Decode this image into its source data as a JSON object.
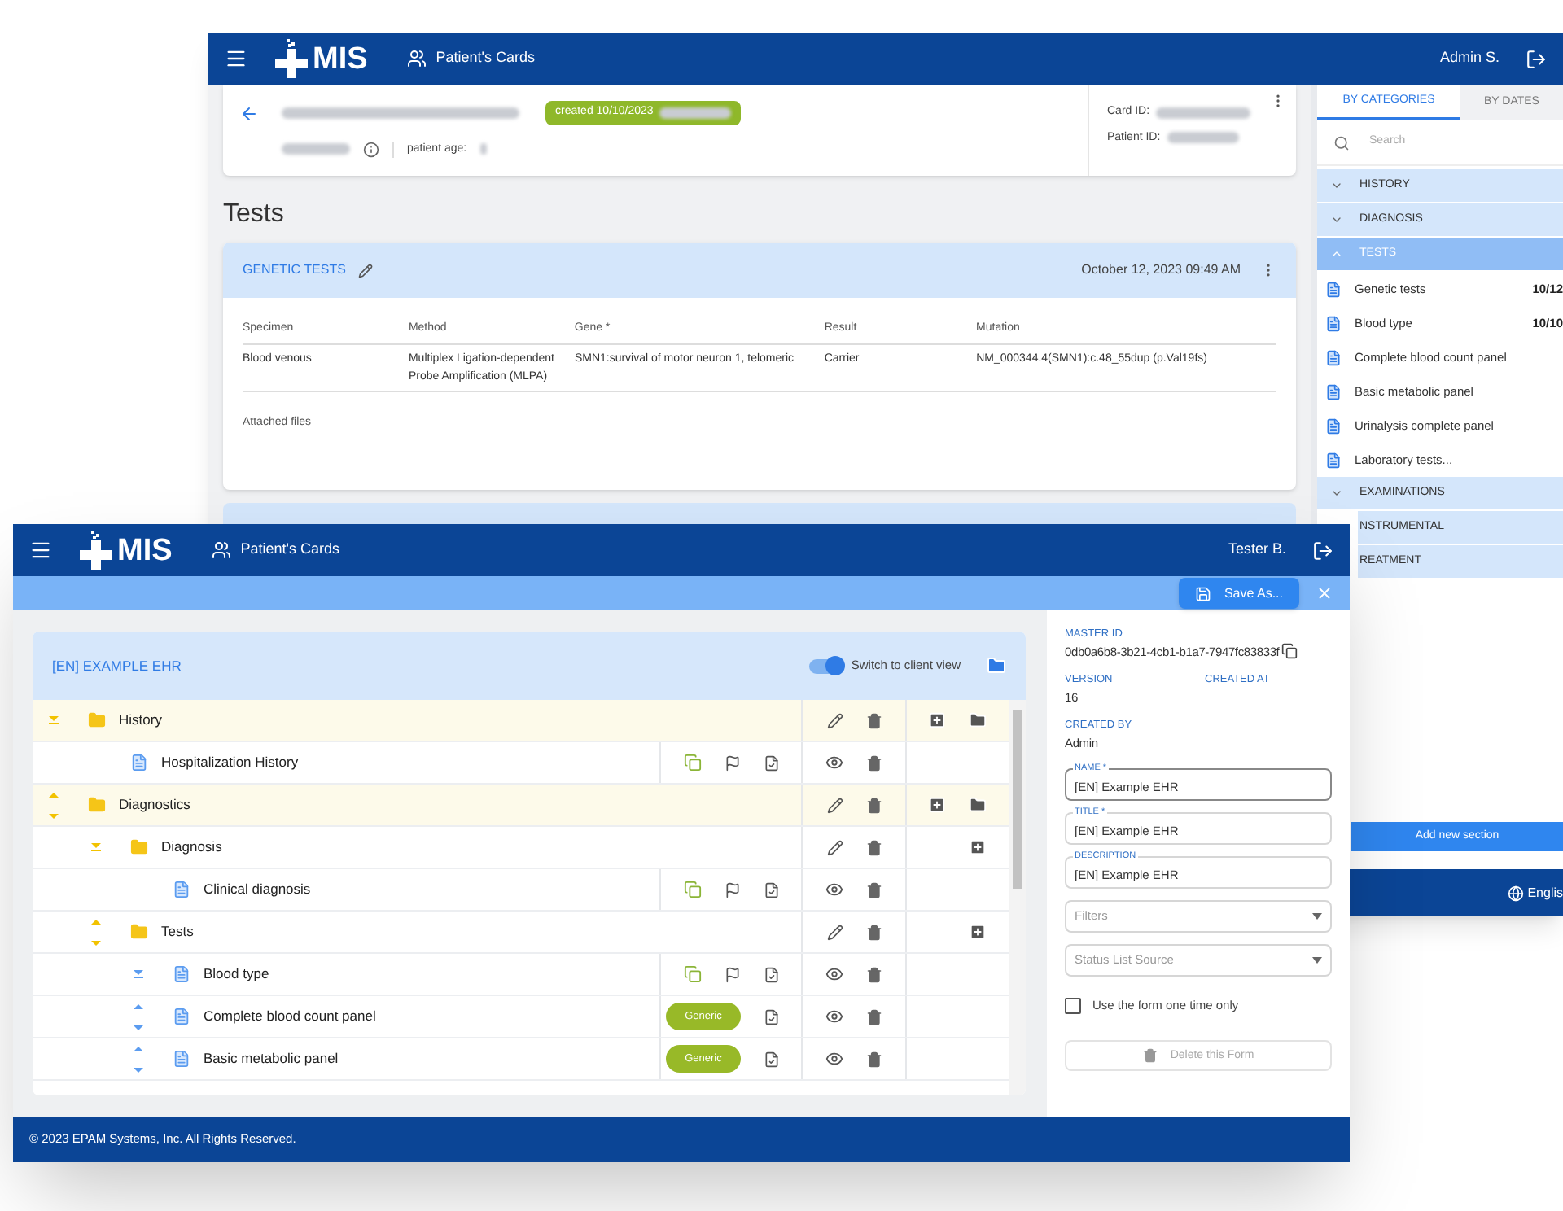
{
  "back_window": {
    "header": {
      "logo": "MIS",
      "nav_label": "Patient's Cards",
      "user": "Admin S."
    },
    "card": {
      "badge": "created 10/10/2023",
      "patient_age_label": "patient age:",
      "card_id_label": "Card ID:",
      "patient_id_label": "Patient ID:"
    },
    "heading": "Tests",
    "section": {
      "title": "GENETIC TESTS",
      "date": "October 12, 2023 09:49 AM",
      "columns": [
        "Specimen",
        "Method",
        "Gene *",
        "Result",
        "Mutation"
      ],
      "rows": [
        [
          "Blood venous",
          "Multiplex Ligation-dependent Probe Amplification (MLPA)",
          "SMN1:survival of motor neuron 1, telomeric",
          "Carrier",
          "NM_000344.4(SMN1):c.48_55dup (p.Val19fs)"
        ]
      ],
      "attached_label": "Attached files"
    },
    "sidebar": {
      "tabs": [
        {
          "label": "BY CATEGORIES",
          "selected": true
        },
        {
          "label": "BY DATES",
          "selected": false
        }
      ],
      "search": {
        "placeholder": "Search"
      },
      "categories": [
        {
          "label": "HISTORY",
          "expanded": false,
          "selected": false
        },
        {
          "label": "DIAGNOSIS",
          "expanded": false,
          "selected": false
        },
        {
          "label": "TESTS",
          "expanded": true,
          "selected": true,
          "items": [
            {
              "label": "Genetic tests",
              "date": "10/12"
            },
            {
              "label": "Blood type",
              "date": "10/10"
            },
            {
              "label": "Complete blood count panel"
            },
            {
              "label": "Basic metabolic panel"
            },
            {
              "label": "Urinalysis complete panel"
            },
            {
              "label": "Laboratory tests..."
            }
          ]
        },
        {
          "label": "EXAMINATIONS",
          "expanded": false,
          "selected": false
        },
        {
          "label": "NSTRUMENTAL",
          "selected": false
        },
        {
          "label": "REATMENT",
          "selected": false
        }
      ],
      "add_button": "Add new section",
      "language": "Englis"
    }
  },
  "front_window": {
    "header": {
      "logo": "MIS",
      "nav_label": "Patient's Cards",
      "user": "Tester B."
    },
    "save_button": "Save As...",
    "form": {
      "title": "[EN] EXAMPLE EHR",
      "client_view": {
        "label": "Switch to client view",
        "on": true
      },
      "tree": [
        {
          "kind": "folder",
          "label": "History",
          "children": [
            {
              "kind": "form",
              "label": "Hospitalization History"
            }
          ]
        },
        {
          "kind": "folder",
          "label": "Diagnostics",
          "children": [
            {
              "kind": "folder",
              "label": "Diagnosis",
              "children": [
                {
                  "kind": "form",
                  "label": "Clinical diagnosis"
                }
              ]
            },
            {
              "kind": "folder",
              "label": "Tests",
              "children": [
                {
                  "kind": "form",
                  "label": "Blood type"
                },
                {
                  "kind": "form",
                  "label": "Complete blood count panel",
                  "badge": "Generic"
                },
                {
                  "kind": "form",
                  "label": "Basic metabolic panel",
                  "badge": "Generic"
                }
              ]
            }
          ]
        }
      ]
    },
    "details": {
      "info": [
        {
          "label": "MASTER ID",
          "value": "0db0a6b8-3b21-4cb1-b1a7-7947fc83833f"
        },
        {
          "label": "VERSION",
          "value": "16"
        },
        {
          "label": "CREATED AT"
        },
        {
          "label": "CREATED BY",
          "value": "Admin"
        }
      ],
      "fields": [
        {
          "label": "NAME *",
          "value": "[EN] Example EHR"
        },
        {
          "label": "TITLE *",
          "value": "[EN] Example EHR"
        },
        {
          "label": "DESCRIPTION",
          "value": "[EN] Example EHR"
        }
      ],
      "selects": [
        {
          "placeholder": "Filters"
        },
        {
          "placeholder": "Status List Source"
        }
      ],
      "checkbox": {
        "label": "Use the form one time only",
        "checked": false
      },
      "delete_button": {
        "label": "Delete this Form",
        "disabled": true
      }
    },
    "footer": "© 2023 EPAM Systems, Inc. All Rights Reserved."
  }
}
